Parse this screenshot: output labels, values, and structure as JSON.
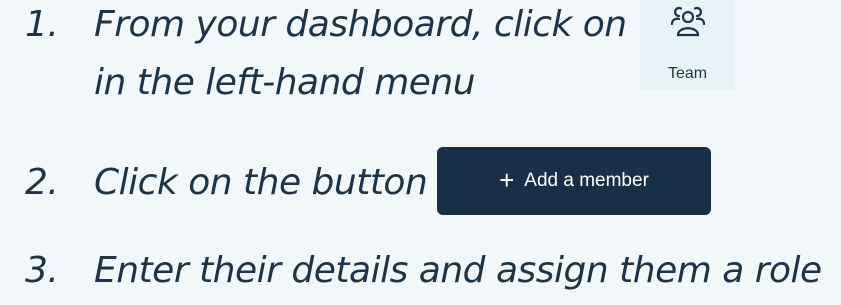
{
  "steps": [
    {
      "number": "1.",
      "line1": "From your dashboard, click on",
      "line2": "in the left-hand menu"
    },
    {
      "number": "2.",
      "text": "Click on the button"
    },
    {
      "number": "3.",
      "text": "Enter their details and assign them a role"
    }
  ],
  "team_card": {
    "label": "Team",
    "icon": "team-icon"
  },
  "add_button": {
    "icon": "plus-icon",
    "label": "Add a member"
  },
  "colors": {
    "background": "#f2f7fa",
    "text": "#1d3347",
    "button_bg": "#172f47",
    "button_text": "#ffffff",
    "team_card_bg": "#e8f3f7"
  }
}
